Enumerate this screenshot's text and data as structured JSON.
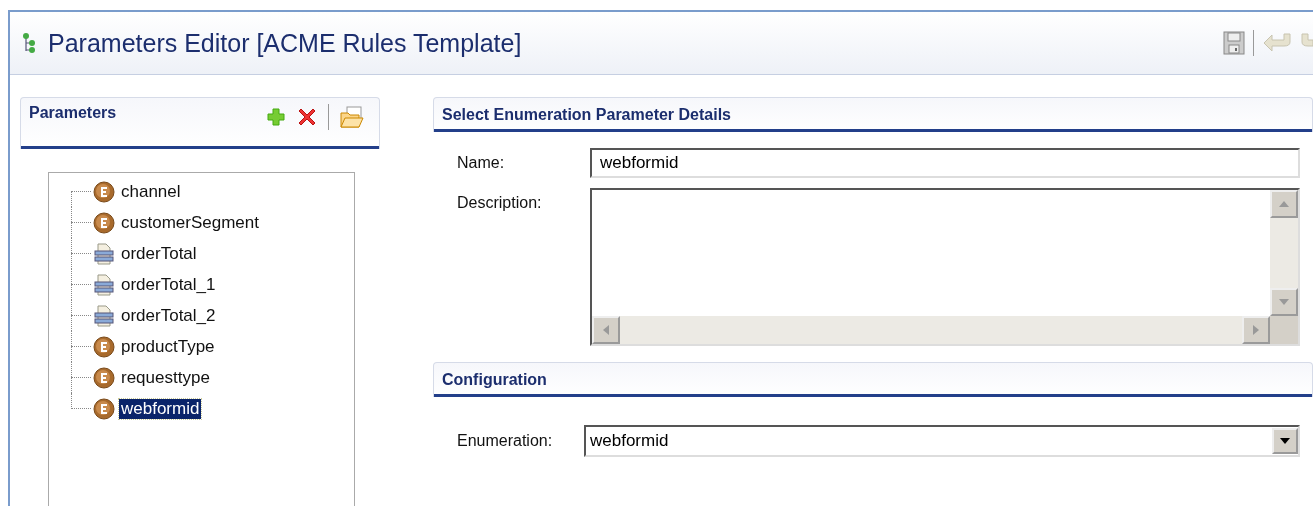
{
  "editor": {
    "title": "Parameters Editor [ACME Rules Template]"
  },
  "parameters": {
    "title": "Parameters",
    "items": [
      {
        "label": "channel",
        "kind": "enum",
        "selected": false
      },
      {
        "label": "customerSegment",
        "kind": "enum",
        "selected": false
      },
      {
        "label": "orderTotal",
        "kind": "table",
        "selected": false
      },
      {
        "label": "orderTotal_1",
        "kind": "table",
        "selected": false
      },
      {
        "label": "orderTotal_2",
        "kind": "table",
        "selected": false
      },
      {
        "label": "productType",
        "kind": "enum",
        "selected": false
      },
      {
        "label": "requesttype",
        "kind": "enum",
        "selected": false
      },
      {
        "label": "webformid",
        "kind": "enum",
        "selected": true
      }
    ]
  },
  "details": {
    "title": "Select Enumeration Parameter Details",
    "name_label": "Name:",
    "name_value": "webformid",
    "description_label": "Description:"
  },
  "configuration": {
    "title": "Configuration",
    "enumeration_label": "Enumeration:",
    "enumeration_value": "webformid"
  }
}
